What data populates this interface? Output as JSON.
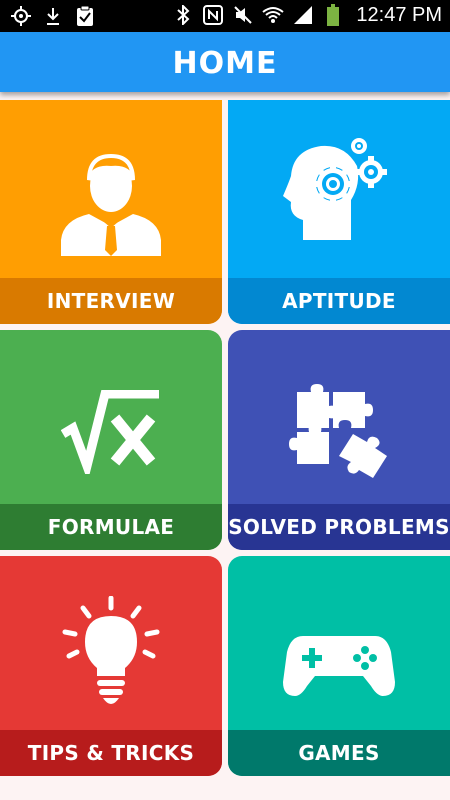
{
  "status_bar": {
    "time": "12:47 PM",
    "icons": [
      "gps-icon",
      "download-icon",
      "clipboard-check-icon",
      "bluetooth-icon",
      "nfc-icon",
      "mute-icon",
      "wifi-icon",
      "signal-icon",
      "battery-icon"
    ]
  },
  "header": {
    "title": "HOME"
  },
  "tiles": [
    {
      "label": "INTERVIEW",
      "icon": "person-icon",
      "color": "#ff9e02"
    },
    {
      "label": "APTITUDE",
      "icon": "head-gears-icon",
      "color": "#03a9f4"
    },
    {
      "label": "FORMULAE",
      "icon": "square-root-icon",
      "color": "#4caf50"
    },
    {
      "label": "SOLVED PROBLEMS",
      "icon": "puzzle-icon",
      "color": "#3f51b5"
    },
    {
      "label": "TIPS & TRICKS",
      "icon": "lightbulb-icon",
      "color": "#e53935"
    },
    {
      "label": "GAMES",
      "icon": "gamepad-icon",
      "color": "#00bfa5"
    }
  ]
}
